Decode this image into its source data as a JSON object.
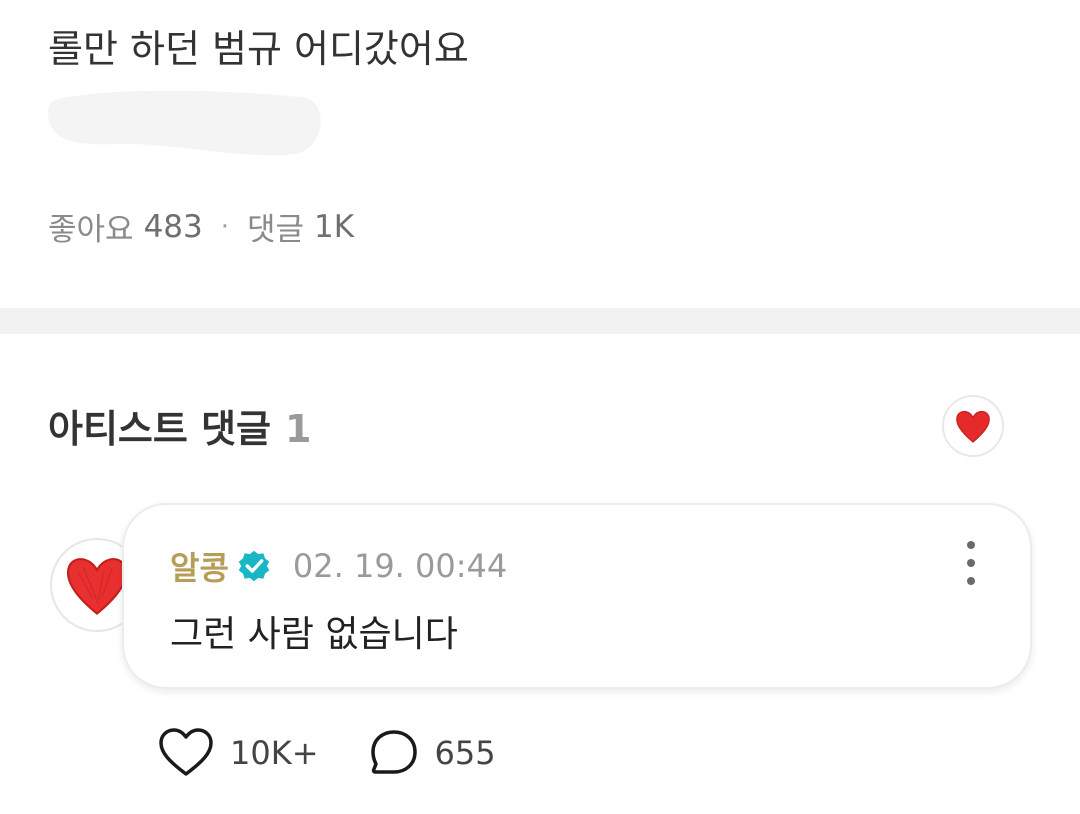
{
  "post": {
    "title": "롤만 하던 범규 어디갔어요",
    "likes_label": "좋아요",
    "likes_count": "483",
    "separator": "·",
    "comments_label": "댓글",
    "comments_count": "1K"
  },
  "artist_comments": {
    "title": "아티스트 댓글",
    "count": "1",
    "badge_icon": "heart-icon"
  },
  "comment": {
    "author": "알콩",
    "verified_icon": "verified-badge-icon",
    "timestamp": "02. 19. 00:44",
    "text": "그런 사람 없습니다",
    "avatar_icon": "heart-icon",
    "likes": "10K+",
    "replies": "655"
  },
  "colors": {
    "author": "#b79d58",
    "verified": "#19b7c6",
    "heart": "#e52a2a",
    "divider": "#f2f2f2"
  }
}
